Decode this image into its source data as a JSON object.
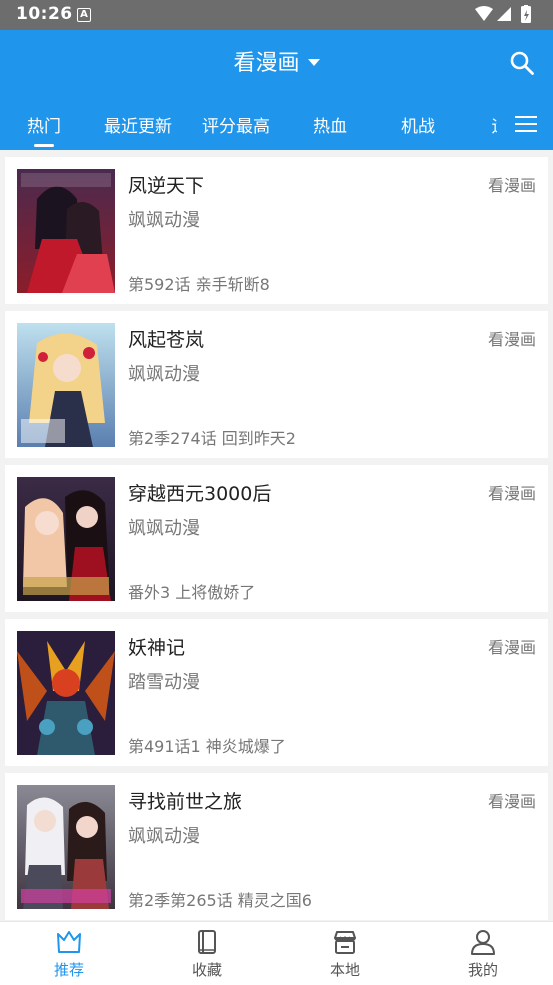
{
  "status": {
    "time": "10:26",
    "notif_letter": "A"
  },
  "header": {
    "title": "看漫画"
  },
  "tabs": [
    "热门",
    "最近更新",
    "评分最高",
    "热血",
    "机战",
    "运"
  ],
  "comics": [
    {
      "title": "凤逆天下",
      "author": "飒飒动漫",
      "chapter": "第592话 亲手斩断8",
      "source": "看漫画"
    },
    {
      "title": "风起苍岚",
      "author": "飒飒动漫",
      "chapter": "第2季274话 回到昨天2",
      "source": "看漫画"
    },
    {
      "title": "穿越西元3000后",
      "author": "飒飒动漫",
      "chapter": "番外3 上将傲娇了",
      "source": "看漫画"
    },
    {
      "title": "妖神记",
      "author": "踏雪动漫",
      "chapter": "第491话1 神炎城爆了",
      "source": "看漫画"
    },
    {
      "title": "寻找前世之旅",
      "author": "飒飒动漫",
      "chapter": "第2季第265话 精灵之国6",
      "source": "看漫画"
    }
  ],
  "bottom_nav": [
    "推荐",
    "收藏",
    "本地",
    "我的"
  ],
  "colors": {
    "primary": "#1f95ec",
    "status_bar": "#6d6d6d"
  }
}
